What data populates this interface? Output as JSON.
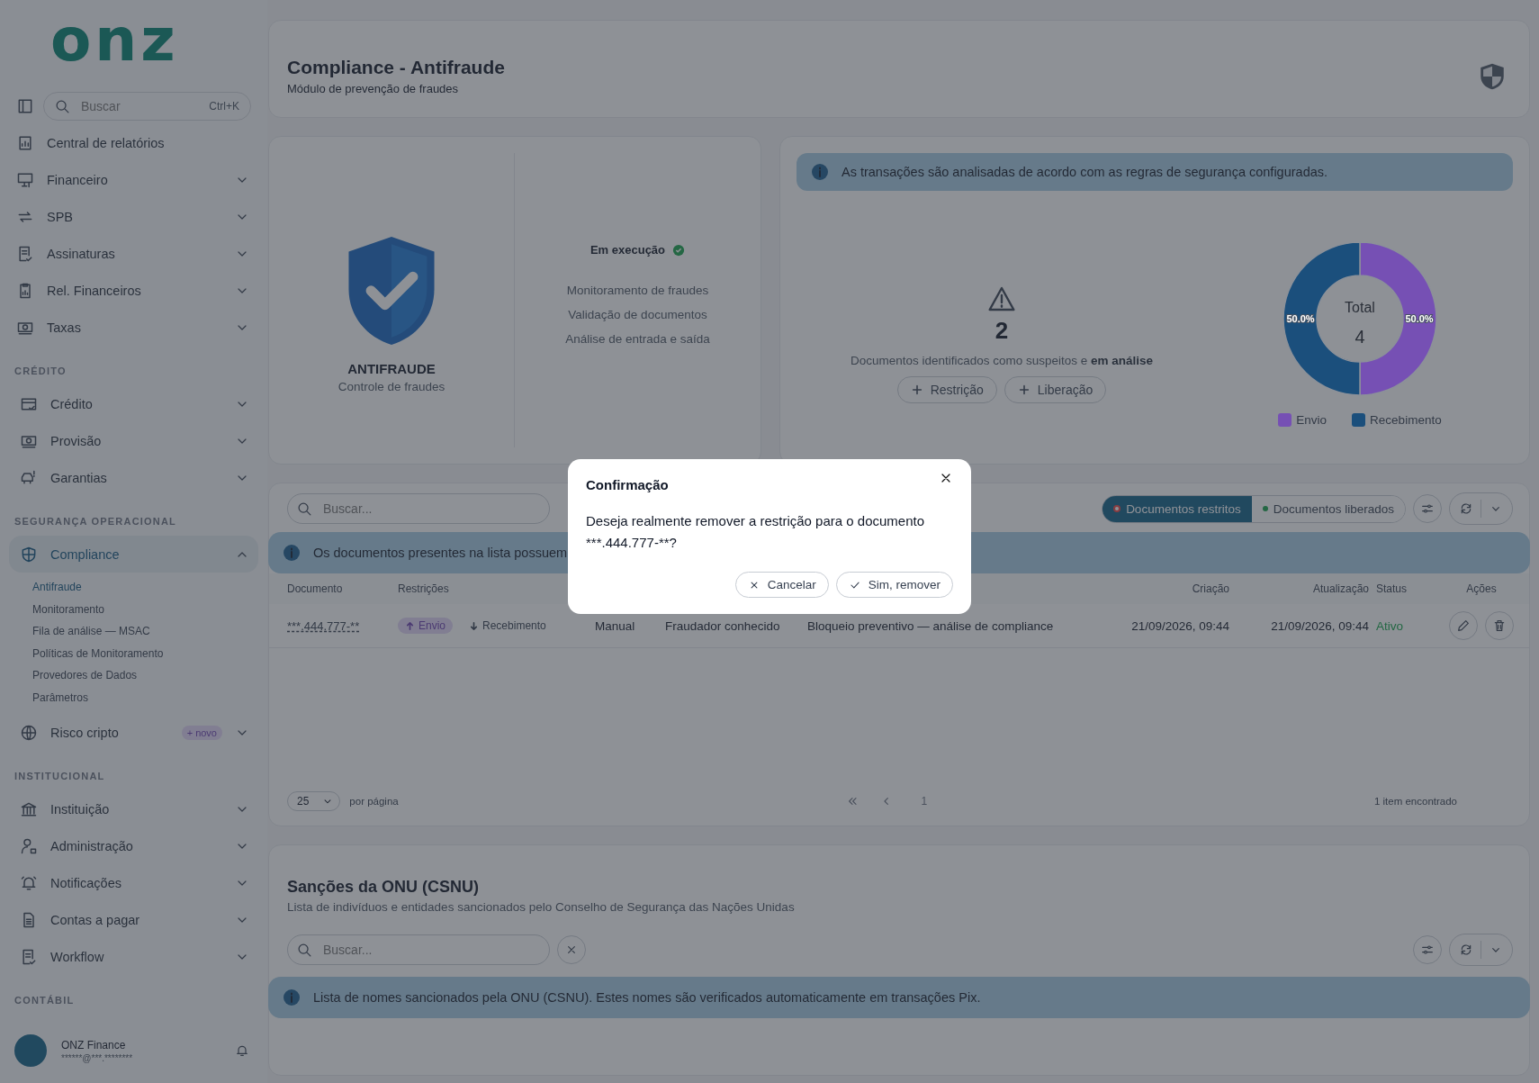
{
  "logo": {
    "text": "onz"
  },
  "sidebar": {
    "search": {
      "placeholder": "Buscar",
      "shortcut": "Ctrl+K"
    },
    "sections": [
      {
        "items": [
          {
            "label": "Central de relatórios",
            "kind": "link",
            "selected": false
          },
          {
            "label": "Financeiro",
            "kind": "group",
            "expanded": false,
            "selected": false
          },
          {
            "label": "SPB",
            "kind": "group",
            "expanded": false,
            "selected": false
          },
          {
            "label": "Assinaturas",
            "kind": "group",
            "expanded": false,
            "selected": false
          },
          {
            "label": "Rel. Financeiros",
            "kind": "group",
            "expanded": false,
            "selected": false
          },
          {
            "label": "Taxas",
            "kind": "group",
            "expanded": false,
            "selected": false
          }
        ]
      },
      {
        "title": "CRÉDITO",
        "items": [
          {
            "label": "Crédito",
            "kind": "group",
            "expanded": false,
            "selected": false
          },
          {
            "label": "Provisão",
            "kind": "group",
            "expanded": false,
            "selected": false
          },
          {
            "label": "Garantias",
            "kind": "group",
            "expanded": false,
            "selected": false
          }
        ]
      },
      {
        "title": "SEGURANÇA OPERACIONAL",
        "items": [
          {
            "label": "Compliance",
            "kind": "group",
            "expanded": true,
            "selected": true,
            "children": [
              {
                "label": "Antifraude",
                "selected": true
              },
              {
                "label": "Monitoramento",
                "selected": false
              },
              {
                "label": "Fila de análise — MSAC",
                "selected": false
              },
              {
                "label": "Políticas de Monitoramento",
                "selected": false
              },
              {
                "label": "Provedores de Dados",
                "selected": false
              },
              {
                "label": "Parâmetros",
                "selected": false
              }
            ]
          },
          {
            "label": "Risco cripto",
            "kind": "group",
            "expanded": false,
            "selected": false,
            "badge": "+ novo"
          }
        ]
      },
      {
        "title": "INSTITUCIONAL",
        "items": [
          {
            "label": "Instituição",
            "kind": "group",
            "expanded": false,
            "selected": false
          },
          {
            "label": "Administração",
            "kind": "group",
            "expanded": false,
            "selected": false
          },
          {
            "label": "Notificações",
            "kind": "group",
            "expanded": false,
            "selected": false
          },
          {
            "label": "Contas a pagar",
            "kind": "group",
            "expanded": false,
            "selected": false
          },
          {
            "label": "Workflow",
            "kind": "group",
            "expanded": false,
            "selected": false
          }
        ]
      },
      {
        "title": "CONTÁBIL"
      }
    ]
  },
  "user": {
    "name": "ONZ Finance",
    "email": "******@***.********"
  },
  "header": {
    "title": "Compliance - Antifraude",
    "subtitle": "Módulo de prevenção de fraudes"
  },
  "status_card": {
    "name": "ANTIFRAUDE",
    "caption": "Controle de fraudes",
    "status": "Em execução",
    "running": true,
    "features": [
      "Monitoramento de fraudes",
      "Validação de documentos",
      "Análise de entrada e saída"
    ]
  },
  "summary": {
    "info": "As transações são analisadas de acordo com as regras de segurança configuradas.",
    "count": "2",
    "description": "Documentos identificados como suspeitos e **em análise**",
    "buttons": [
      "Restrição",
      "Liberação"
    ],
    "total_label": "Total",
    "total": "4",
    "chart_data": {
      "type": "donut",
      "categories": [
        "Envio",
        "Recebimento"
      ],
      "values": [
        50.0,
        50.0
      ],
      "value_labels": [
        "50.0%",
        "50.0%"
      ]
    },
    "legend": [
      {
        "color": "#7650b4"
      },
      {
        "color": "#1b4f7c"
      }
    ]
  },
  "documents": {
    "search": {
      "placeholder": "Buscar..."
    },
    "filters": [
      {
        "label": "Documentos restritos",
        "selected": true
      },
      {
        "label": "Documentos liberados",
        "selected": false
      }
    ],
    "info": "Os documentos presentes na lista possuem",
    "columns": [
      "Documento",
      "Restrições",
      "Criação",
      "Atualização",
      "Status",
      "Ações"
    ],
    "rows": [
      {
        "document": "***.444.777-**",
        "restrictions": [
          {
            "label": "Envio",
            "active": true
          },
          {
            "label": "Recebimento",
            "active": false
          }
        ],
        "origin": "Manual",
        "reason": "Fraudador conhecido",
        "note": "Bloqueio preventivo — análise de compliance",
        "created": "21/09/2026, 09:44",
        "updated": "21/09/2026, 09:44",
        "status": "Ativo"
      }
    ],
    "page_size": "25",
    "per_page": "por página",
    "page": "1",
    "found": "1 item encontrado"
  },
  "sanctions": {
    "title": "Sanções da ONU (CSNU)",
    "subtitle": "Lista de indivíduos e entidades sancionados pelo Conselho de Segurança das Nações Unidas",
    "search": {
      "placeholder": "Buscar..."
    },
    "info": "Lista de nomes sancionados pela ONU (CSNU). Estes nomes são verificados automaticamente em transações Pix."
  },
  "dialog": {
    "title": "Confirmação",
    "message": "Deseja realmente remover a restrição para o documento ***.444.777-**?",
    "buttons": [
      {
        "label": "Cancelar",
        "kind": "cancel"
      },
      {
        "label": "Sim, remover",
        "kind": "confirm"
      }
    ]
  }
}
